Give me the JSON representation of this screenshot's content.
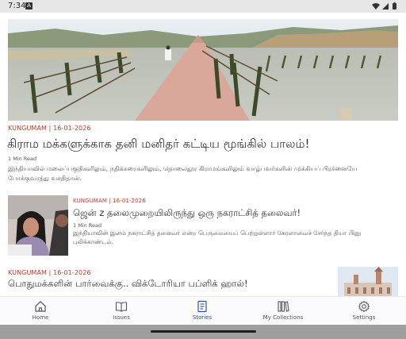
{
  "status_bar": {
    "time": "7:34",
    "notification_badge": "A",
    "icons": [
      "wifi-icon",
      "signal-icon",
      "battery-icon"
    ]
  },
  "articles": [
    {
      "source": "KUNGUMAM | 16-01-2026",
      "title": "கிராம மக்களுக்காக தனி மனிதர் கட்டிய மூங்கில் பாலம்!",
      "read_time": "1 Min Read",
      "excerpt": "இந்தியாவில் மலைப்பகுதிகளிலும், நதிக்கரைகளிலும், தொலைதூர கிராமங்களிலும் வாழ்பவர்களின் முக்கியப் பிரச்னையே போக்குவரத்து வசதிதான்.",
      "image": "bamboo-bridge-photo"
    },
    {
      "source": "KUNGUMAM | 16-01-2026",
      "title": "ஜென் z தலைமுறையிலிருந்து ஒரு நகராட்சித் தலைவர்!",
      "read_time": "1 Min Read",
      "excerpt": "இந்தியாவின் இளம் நகராட்சித் தலைவர் என்ற பெருமையைப் பெற்றுள்ளார் கேரளாவைச் சேர்ந்த தியா பினு புலிக்காண்டம்.",
      "image": "young-councillor-photo"
    },
    {
      "source": "KUNGUMAM | 16-01-2026",
      "title": "பொதுமக்களின் பார்வைக்கு.. விக்டோரியா பப்ளிக் ஹால்!",
      "image": "victoria-public-hall-photo"
    }
  ],
  "bottom_nav": {
    "active": "Stories",
    "items": [
      {
        "label": "Home",
        "icon": "home-icon"
      },
      {
        "label": "Issues",
        "icon": "book-open-icon"
      },
      {
        "label": "Stories",
        "icon": "stories-icon"
      },
      {
        "label": "My Collections",
        "icon": "collections-icon"
      },
      {
        "label": "Settings",
        "icon": "gear-icon"
      }
    ]
  },
  "colors": {
    "source": "#c0392b",
    "active_nav": "#2b4fa8",
    "text": "#333333"
  }
}
